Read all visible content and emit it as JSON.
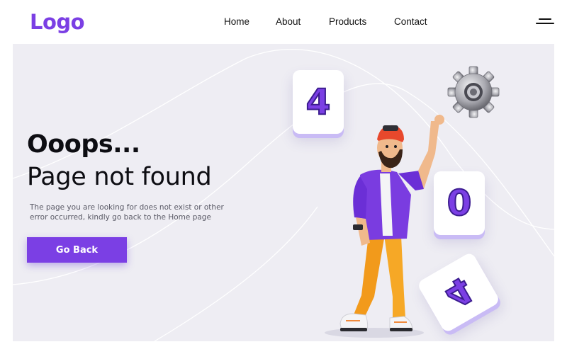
{
  "header": {
    "logo": "Logo",
    "nav": [
      {
        "label": "Home"
      },
      {
        "label": "About"
      },
      {
        "label": "Products"
      },
      {
        "label": "Contact"
      }
    ]
  },
  "hero": {
    "title_line1": "Ooops...",
    "title_line2": "Page not found",
    "description": "The page you are looking for does not exist or other error occurred, kindly go back to the Home page",
    "button_label": "Go Back",
    "tiles": [
      "4",
      "0",
      "4"
    ]
  },
  "colors": {
    "accent": "#7b3fe4",
    "hero_bg": "#eeedf3",
    "text_dark": "#0d0d12"
  }
}
